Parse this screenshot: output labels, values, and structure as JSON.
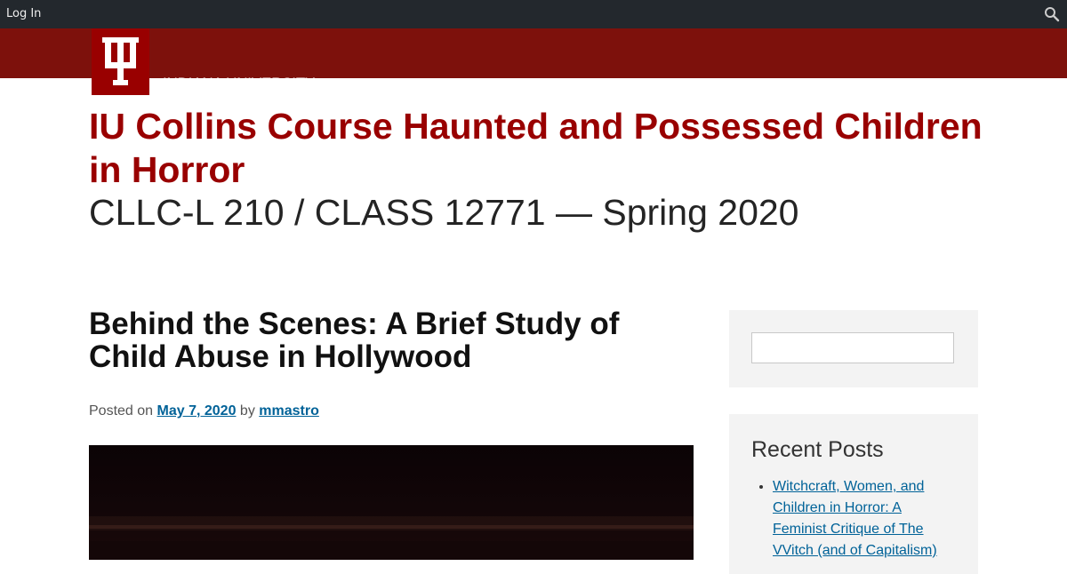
{
  "admin_bar": {
    "login_label": "Log In",
    "search_icon": "search-icon"
  },
  "branding": {
    "logo_icon": "iu-trident-icon",
    "university_name": "INDIANA UNIVERSITY",
    "colors": {
      "crimson": "#990000",
      "bar": "#7d110c",
      "link": "#006298"
    }
  },
  "site": {
    "title": "IU Collins Course Haunted and Possessed Children in Horror",
    "subtitle": "CLLC-L 210 / CLASS 12771 — Spring 2020"
  },
  "post": {
    "title": "Behind the Scenes: A Brief Study of Child Abuse in Hollywood",
    "meta_prefix": "Posted on",
    "date": "May 7, 2020",
    "meta_by": "by",
    "author": "mmastro"
  },
  "sidebar": {
    "search_value": "",
    "recent_posts_title": "Recent Posts",
    "recent_posts": [
      "Witchcraft, Women, and Children in Horror: A Feminist Critique of The VVitch (and of Capitalism)"
    ]
  }
}
